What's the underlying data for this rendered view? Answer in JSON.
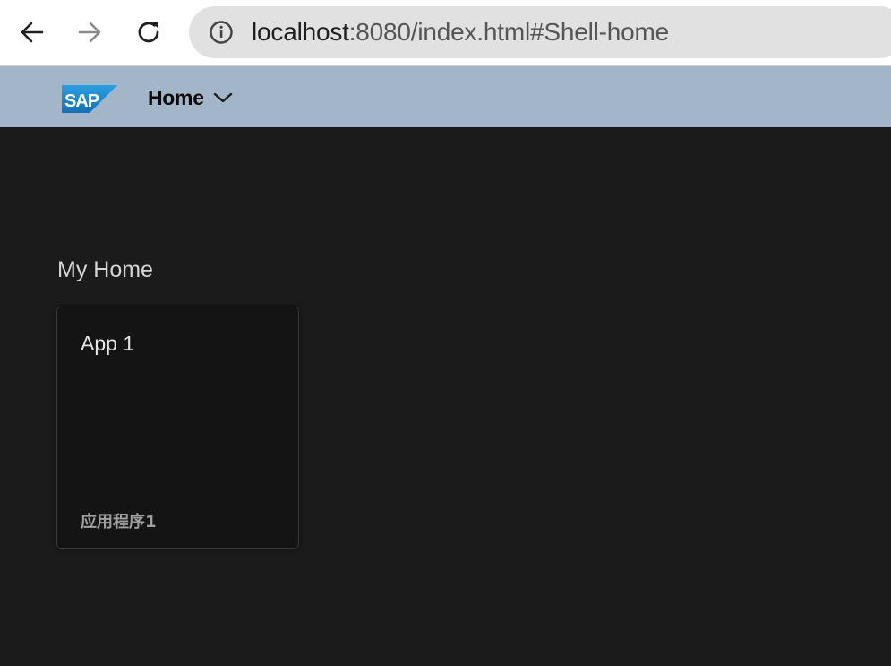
{
  "browser": {
    "url_host": "localhost",
    "url_rest": ":8080/index.html#Shell-home",
    "icons": [
      "back-arrow-icon",
      "forward-arrow-icon",
      "reload-icon",
      "info-icon"
    ]
  },
  "shell": {
    "logo_text": "SAP",
    "home_label": "Home",
    "header_color": "#a3b6c9",
    "logo_color": "#1e88c8"
  },
  "main": {
    "section_title": "My Home",
    "tiles": [
      {
        "title": "App 1",
        "subtitle": "应用程序1"
      }
    ],
    "background": "#1b1b1b"
  }
}
